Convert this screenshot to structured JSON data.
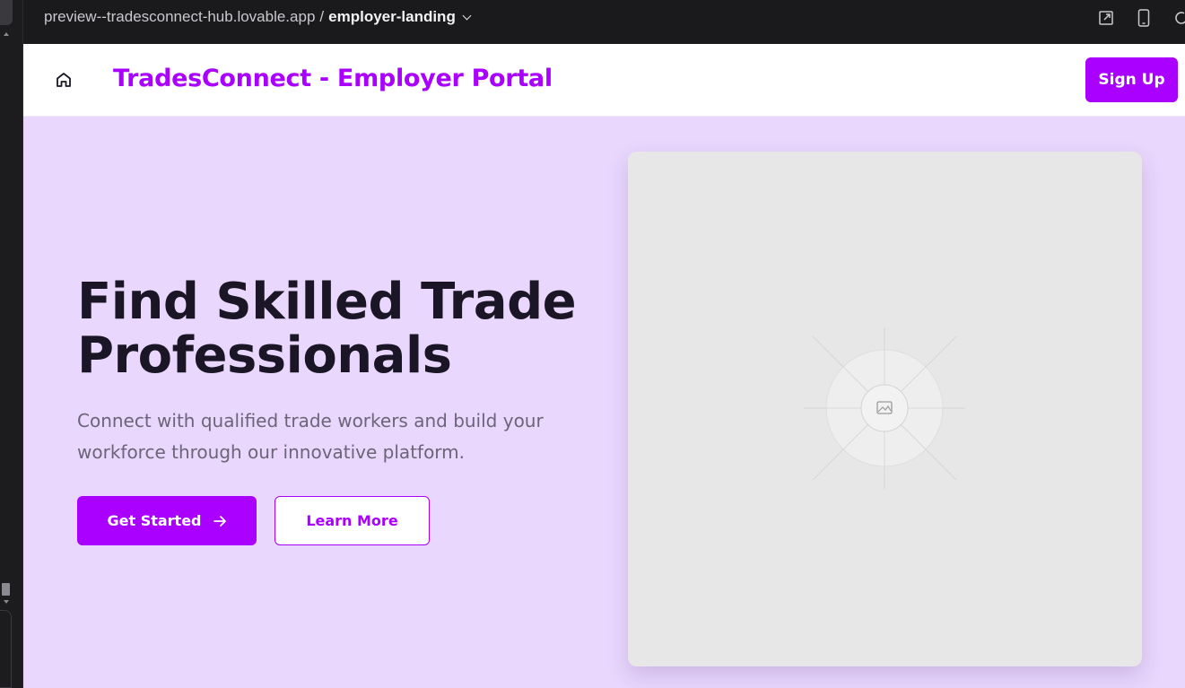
{
  "browser": {
    "url_host": "preview--tradesconnect-hub.lovable.app",
    "url_separator": "/",
    "url_route": "employer-landing",
    "icons": [
      "open-external-icon",
      "mobile-preview-icon",
      "refresh-icon"
    ]
  },
  "navbar": {
    "home_icon": "home-icon",
    "brand": "TradesConnect - Employer Portal",
    "signup_label": "Sign Up"
  },
  "hero": {
    "title": "Find Skilled Trade Professionals",
    "subtitle": "Connect with qualified trade workers and build your workforce through our innovative platform.",
    "primary_cta": "Get Started",
    "primary_cta_icon": "arrow-right-icon",
    "secondary_cta": "Learn More",
    "image_icon": "image-placeholder-icon"
  },
  "colors": {
    "accent": "#aa00ff",
    "hero_bg": "#e9d7fd",
    "title": "#1a1625",
    "subtitle": "#6c6478",
    "card_bg": "#e7e7e7",
    "browser_bar": "#1a1a1d"
  }
}
